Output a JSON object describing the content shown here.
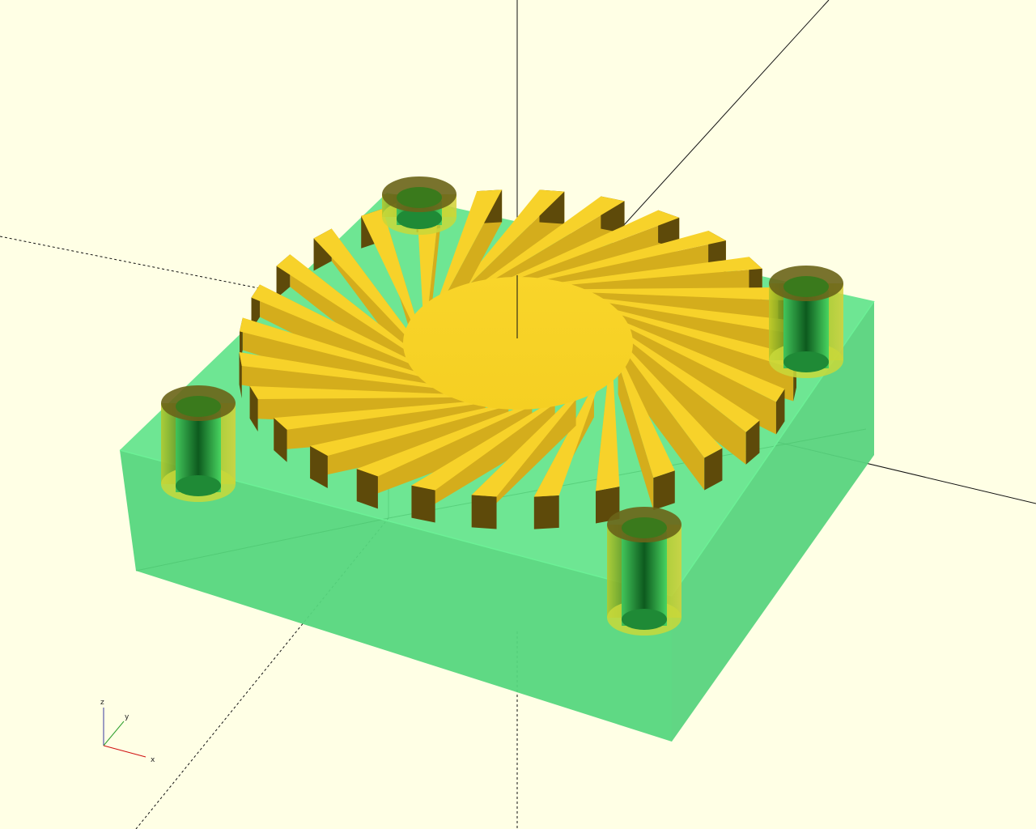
{
  "app": {
    "type": "3d-model-viewport"
  },
  "colors": {
    "background": "#ffffe5",
    "base_box": "#56de7d",
    "base_box_edge": "#3bb864",
    "fan_blades": "#f7d22a",
    "fan_blades_shadow": "#5e4a0a",
    "posts": "#9ed83a",
    "post_inner": "#2ea84a",
    "axis_x": "#d00000",
    "axis_y": "#00a000",
    "axis_z": "#0000c0",
    "axis_lines": "#111111"
  },
  "axes_indicator": {
    "x_label": "x",
    "y_label": "y",
    "z_label": "z"
  },
  "model": {
    "blade_count": 28,
    "mounting_posts": 4,
    "icons": [
      "fan-icon"
    ]
  }
}
